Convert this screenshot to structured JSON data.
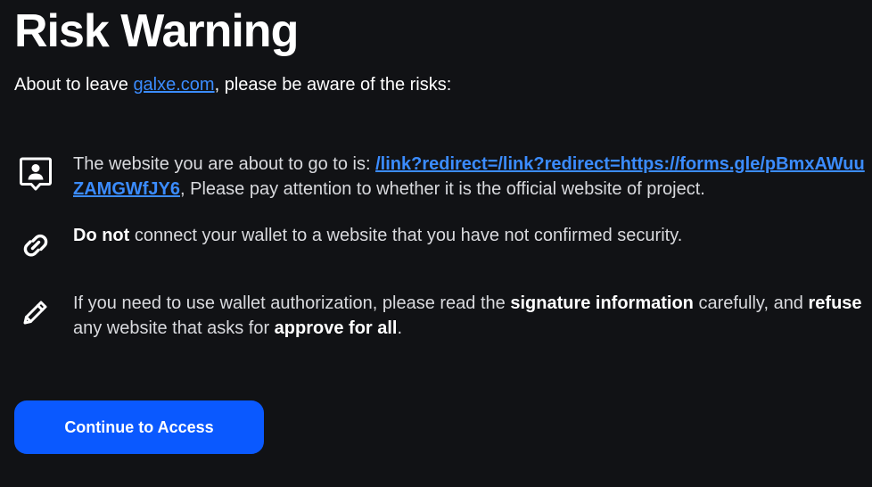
{
  "header": {
    "title": "Risk Warning",
    "subtitle_prefix": "About to leave ",
    "subtitle_link": "galxe.com",
    "subtitle_suffix": ", please be aware of the risks:"
  },
  "risks": [
    {
      "icon": "person-badge-icon",
      "text_prefix": "The website you are about to go to is: ",
      "link": "/link?redirect=/link?redirect=https://forms.gle/pBmxAWuuZAMGWfJY6",
      "text_suffix": ", Please pay attention to whether it is the official website of project."
    },
    {
      "icon": "link-icon",
      "bold_prefix": "Do not",
      "text": " connect your wallet to a website that you have not confirmed security."
    },
    {
      "icon": "pencil-icon",
      "part1": "If you need to use wallet authorization, please read the ",
      "bold1": "signature information",
      "part2": " carefully, and ",
      "bold2": "refuse",
      "part3": " any website that asks for ",
      "bold3": "approve for all",
      "part4": "."
    }
  ],
  "actions": {
    "continue_label": "Continue to Access"
  },
  "colors": {
    "background": "#111215",
    "accent": "#0a59ff",
    "link": "#3b8cff"
  }
}
